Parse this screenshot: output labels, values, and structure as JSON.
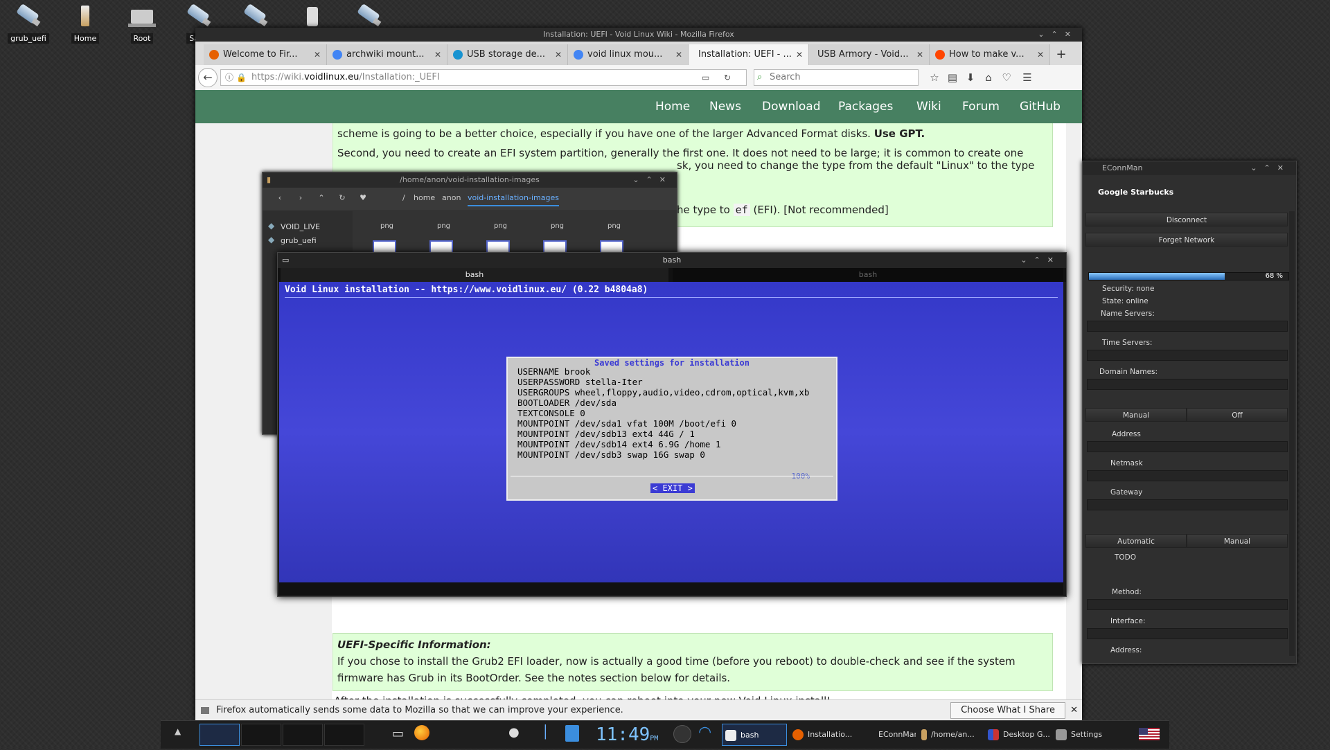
{
  "desktop": {
    "icons": [
      {
        "label": "grub_uefi",
        "icon": "usb-drive-icon"
      },
      {
        "label": "Home",
        "icon": "home-folder-icon"
      },
      {
        "label": "Root",
        "icon": "computer-icon"
      },
      {
        "label": "Saba",
        "icon": "usb-drive-icon"
      },
      {
        "label": "",
        "icon": "usb-drive-icon"
      },
      {
        "label": "",
        "icon": "removable-drive-icon"
      },
      {
        "label": "",
        "icon": "usb-drive-icon"
      }
    ]
  },
  "firefox": {
    "title": "Installation: UEFI - Void Linux Wiki - Mozilla Firefox",
    "tabs": [
      {
        "label": "Welcome to Fir...",
        "color": "#e66000"
      },
      {
        "label": "archwiki mount...",
        "color": "#4285f4"
      },
      {
        "label": "USB storage de...",
        "color": "#1793d1"
      },
      {
        "label": "void linux mou...",
        "color": "#4285f4"
      },
      {
        "label": "Installation: UEFI - ...",
        "color": "#478061"
      },
      {
        "label": "USB Armory - Void...",
        "color": "#478061"
      },
      {
        "label": "How to make v...",
        "color": "#ff4500"
      }
    ],
    "url_prefix": "https://wiki.",
    "url_host": "voidlinux.eu",
    "url_path": "/Installation:_UEFI",
    "search_placeholder": "Search",
    "site_nav": [
      "Home",
      "News",
      "Download",
      "Packages",
      "Wiki",
      "Forum",
      "GitHub"
    ],
    "content": {
      "p1_tail": "scheme is going to be a better choice, especially if you have one of the larger Advanced Format disks.",
      "p1_bold": "Use GPT.",
      "p2": "Second, you need to create an EFI system partition, generally the first one. It does not need to be large; it is common to create one",
      "p2_tail": "sk, you need to change the type from the default \"Linux\" to the type",
      "p3_pre": "he type to",
      "p3_code": "ef",
      "p3_post": "(EFI). [Not recommended]",
      "uefi_heading": "UEFI-Specific Information:",
      "uefi_body": "If you chose to install the Grub2 EFI loader, now is actually a good time (before you reboot) to double-check and see if the system firmware has Grub in its BootOrder. See the notes section below for details.",
      "after": "After the installation is successfully completed, you can reboot into your new Void Linux install!"
    },
    "notification": "Firefox automatically sends some data to Mozilla so that we can improve your experience.",
    "notification_button": "Choose What I Share"
  },
  "file_manager": {
    "title": "/home/anon/void-installation-images",
    "breadcrumbs": [
      "/",
      "home",
      "anon",
      "void-installation-images"
    ],
    "sidebar": [
      "VOID_LIVE",
      "grub_uefi"
    ],
    "items": [
      "png",
      "png",
      "png",
      "png",
      "png"
    ]
  },
  "terminal": {
    "title": "bash",
    "tabs": [
      "bash",
      "bash"
    ],
    "header": "Void Linux installation -- https://www.voidlinux.eu/ (0.22 b4804a8)",
    "dialog_title": "Saved settings for installation",
    "lines": [
      "USERNAME brook",
      "USERPASSWORD stella-Iter",
      "USERGROUPS wheel,floppy,audio,video,cdrom,optical,kvm,xb",
      "BOOTLOADER /dev/sda",
      "TEXTCONSOLE 0",
      "MOUNTPOINT /dev/sda1 vfat 100M /boot/efi 0",
      "MOUNTPOINT /dev/sdb13 ext4 44G / 1",
      "MOUNTPOINT /dev/sdb14 ext4 6.9G /home 1",
      "MOUNTPOINT /dev/sdb3 swap 16G swap 0"
    ],
    "percent": "100%",
    "exit_label": "< EXIT >"
  },
  "econnman": {
    "title": "EConnMan",
    "network": "Google Starbucks",
    "disconnect": "Disconnect",
    "forget": "Forget Network",
    "signal_percent": 68,
    "signal_label": "68 %",
    "security": "Security: none",
    "state": "State: online",
    "name_servers": "Name Servers:",
    "time_servers": "Time Servers:",
    "domain_names": "Domain Names:",
    "ipv4_manual": "Manual",
    "ipv4_off": "Off",
    "address": "Address",
    "netmask": "Netmask",
    "gateway": "Gateway",
    "auto": "Automatic",
    "manual": "Manual",
    "todo": "TODO",
    "method": "Method:",
    "interface": "Interface:",
    "address2": "Address:"
  },
  "taskbar": {
    "clock": "11:49",
    "clock_suffix": "PM",
    "tasks": [
      {
        "label": "bash",
        "color": "#eee"
      },
      {
        "label": "Installatio...",
        "color": "#e66000"
      },
      {
        "label": "EConnMan",
        "color": "#555"
      },
      {
        "label": "/home/an...",
        "color": "#c8a060"
      },
      {
        "label": "Desktop G...",
        "color": "#3355cc"
      },
      {
        "label": "Settings",
        "color": "#999"
      }
    ]
  }
}
